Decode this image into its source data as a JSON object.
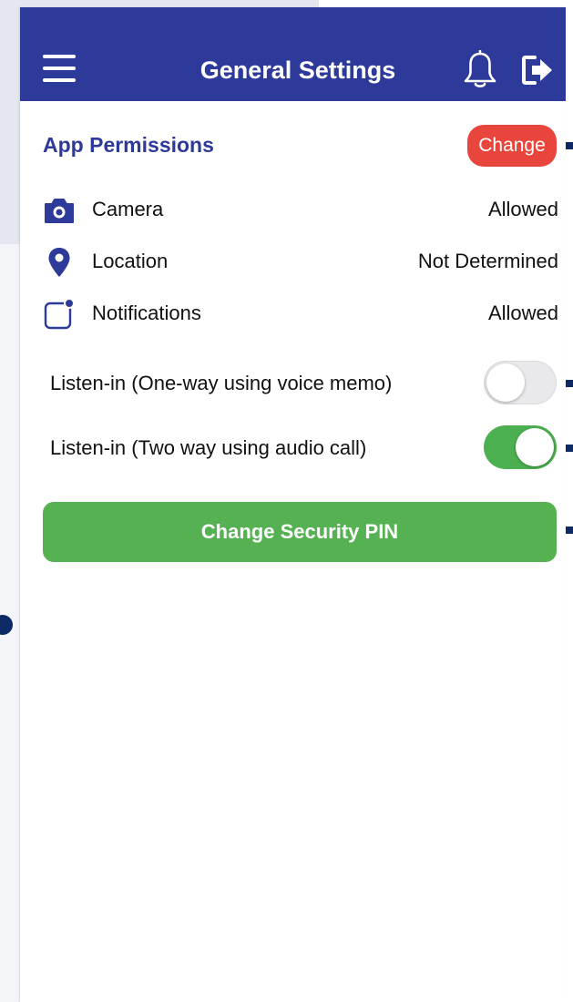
{
  "header": {
    "title": "General Settings",
    "menu_icon": "hamburger-menu-icon",
    "bell_icon": "bell-icon",
    "logout_icon": "logout-icon"
  },
  "permissions": {
    "section_title": "App Permissions",
    "change_label": "Change",
    "items": [
      {
        "icon": "camera-icon",
        "label": "Camera",
        "value": "Allowed"
      },
      {
        "icon": "location-pin-icon",
        "label": "Location",
        "value": "Not Determined"
      },
      {
        "icon": "notification-badge-icon",
        "label": "Notifications",
        "value": "Allowed"
      }
    ]
  },
  "toggles": [
    {
      "label": "Listen-in (One-way using voice memo)",
      "state": "off"
    },
    {
      "label": "Listen-in (Two way using audio call)",
      "state": "on"
    }
  ],
  "actions": {
    "change_pin_label": "Change Security PIN"
  },
  "colors": {
    "app_bar": "#2e3a99",
    "accent_text": "#2e3a99",
    "change_button": "#e8463c",
    "toggle_on": "#4caf50",
    "primary_button": "#55b152"
  }
}
